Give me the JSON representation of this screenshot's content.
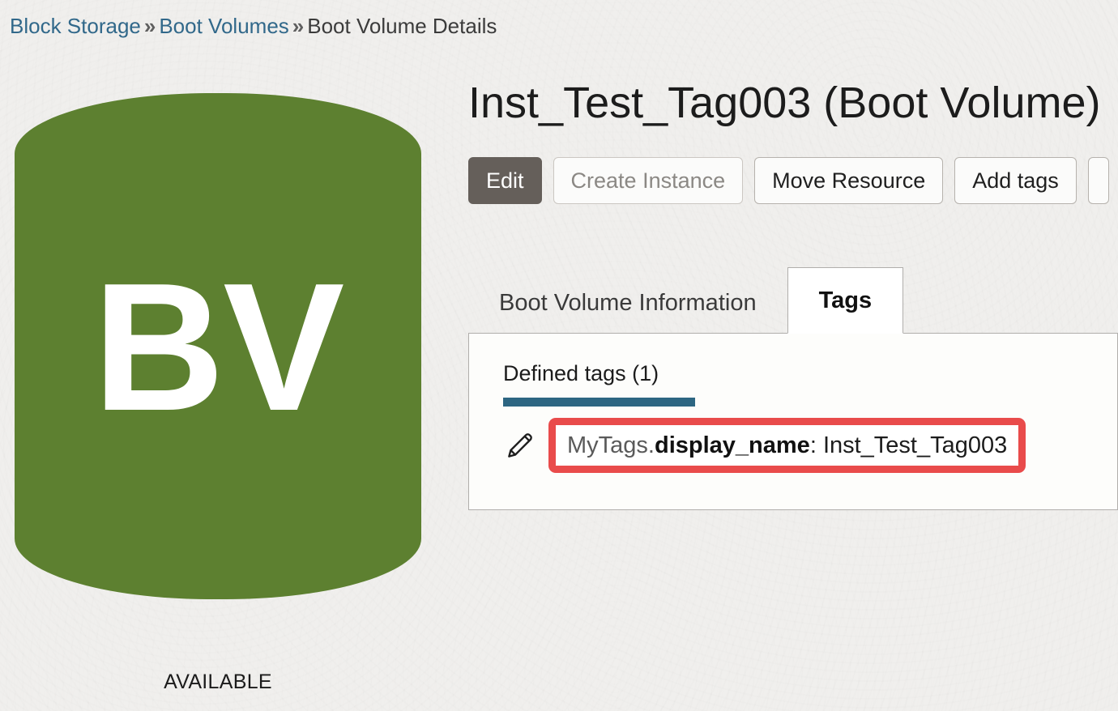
{
  "breadcrumb": {
    "items": [
      {
        "label": "Block Storage",
        "type": "link"
      },
      {
        "label": "Boot Volumes",
        "type": "link"
      },
      {
        "label": "Boot Volume Details",
        "type": "current"
      }
    ],
    "separator": "»"
  },
  "resource": {
    "icon_initials": "BV",
    "icon_name": "boot-volume-icon",
    "icon_color": "#5d8030",
    "status": "AVAILABLE"
  },
  "header": {
    "title": "Inst_Test_Tag003 (Boot Volume)"
  },
  "actions": [
    {
      "label": "Edit",
      "style": "primary",
      "name": "edit-button"
    },
    {
      "label": "Create Instance",
      "style": "disabled",
      "name": "create-instance-button"
    },
    {
      "label": "Move Resource",
      "style": "default",
      "name": "move-resource-button"
    },
    {
      "label": "Add tags",
      "style": "default",
      "name": "add-tags-button"
    }
  ],
  "tabs": [
    {
      "label": "Boot Volume Information",
      "active": false,
      "name": "tab-boot-volume-information"
    },
    {
      "label": "Tags",
      "active": true,
      "name": "tab-tags"
    }
  ],
  "tags_panel": {
    "defined_tags_heading": "Defined tags (1)",
    "underline_color": "#2d6682",
    "highlight_color": "#e94b4b",
    "rows": [
      {
        "namespace": "MyTags.",
        "key": "display_name",
        "separator": ": ",
        "value": "Inst_Test_Tag003",
        "highlighted": true
      }
    ]
  }
}
